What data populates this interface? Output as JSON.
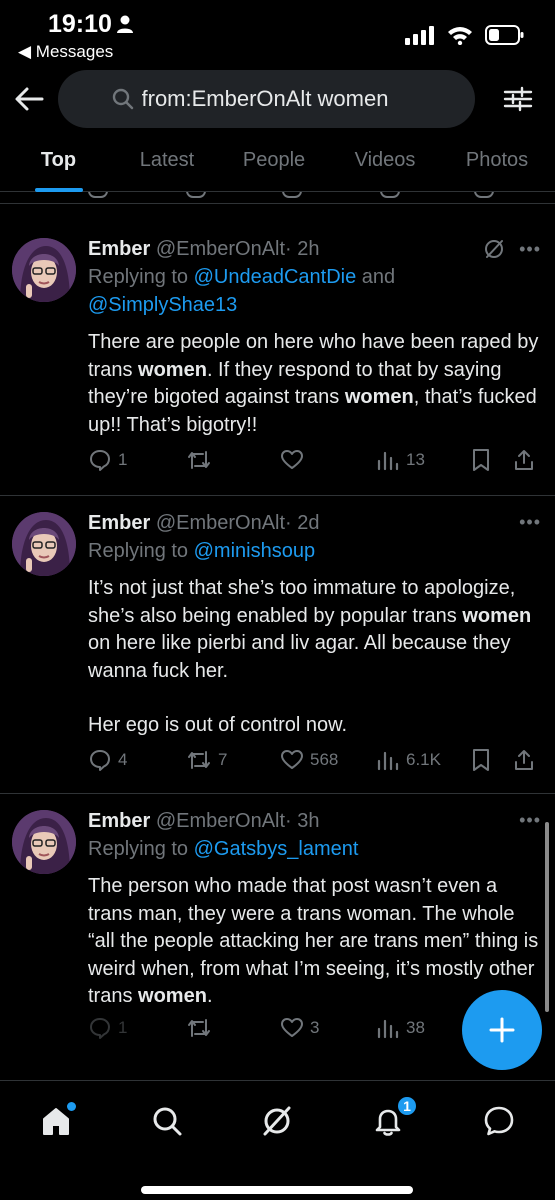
{
  "status_bar": {
    "time": "19:10",
    "back_app": "◀ Messages"
  },
  "search": {
    "query": "from:EmberOnAlt women"
  },
  "tabs": [
    {
      "label": "Top",
      "active": true
    },
    {
      "label": "Latest",
      "active": false
    },
    {
      "label": "People",
      "active": false
    },
    {
      "label": "Videos",
      "active": false
    },
    {
      "label": "Photos",
      "active": false
    }
  ],
  "tweets": [
    {
      "name": "Ember",
      "handle": "@EmberOnAlt",
      "time": "· 2h",
      "replying_prefix": "Replying to ",
      "replying_to_1": "@UndeadCantDie",
      "replying_and": " and",
      "replying_to_2": "@SimplyShae13",
      "text_1": "There are people on here who have been raped by trans ",
      "bold_1": "women",
      "text_2": ". If they respond to that by saying they’re bigoted against trans ",
      "bold_2": "women",
      "text_3": ", that’s fucked up!! That’s bigotry!!",
      "replies": "1",
      "retweets": "",
      "likes": "",
      "views": "13"
    },
    {
      "name": "Ember",
      "handle": "@EmberOnAlt",
      "time": "· 2d",
      "replying_prefix": "Replying to ",
      "replying_to_1": "@minishsoup",
      "text_1": "It’s not just that she’s too immature to apologize, she’s also being enabled by popular trans ",
      "bold_1": "women",
      "text_2": " on here like pierbi and liv agar. All because they wanna fuck her.",
      "text_3": "Her ego is out of control now.",
      "replies": "4",
      "retweets": "7",
      "likes": "568",
      "views": "6.1K"
    },
    {
      "name": "Ember",
      "handle": "@EmberOnAlt",
      "time": "· 3h",
      "replying_prefix": "Replying to ",
      "replying_to_1": "@Gatsbys_lament",
      "text_1": "The person who made that post wasn’t even a trans man, they were a trans woman. The whole “all the people attacking her are trans men” thing is weird when, from what I’m seeing, it’s mostly other trans ",
      "bold_1": "women",
      "text_2": ".",
      "replies": "1",
      "retweets": "",
      "likes": "3",
      "views": "38"
    }
  ],
  "bottom_nav": {
    "notification_count": "1"
  },
  "colors": {
    "accent": "#1d9bf0",
    "background": "#000000",
    "text": "#e7e9ea",
    "muted": "#71767b"
  }
}
